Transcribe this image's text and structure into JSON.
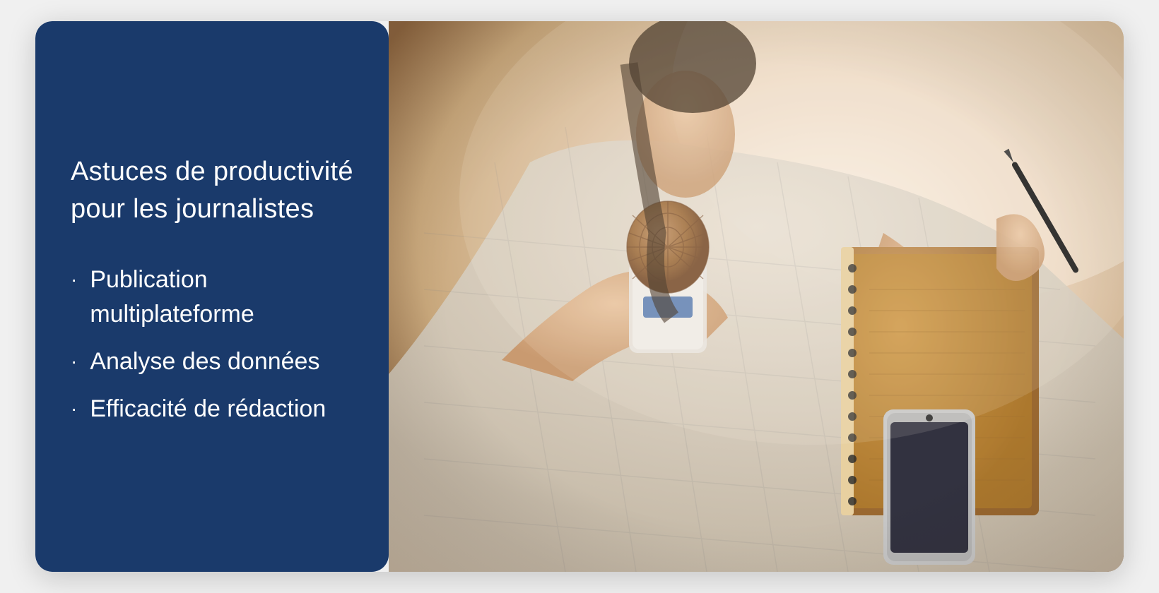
{
  "left_panel": {
    "background_color": "#1a3a6b",
    "title_line1": "Astuces de productivité",
    "title_line2": "pour les journalistes",
    "bullets": [
      {
        "id": "bullet-1",
        "label": "Publication multiplateforme"
      },
      {
        "id": "bullet-2",
        "label": "Analyse des données"
      },
      {
        "id": "bullet-3",
        "label": "Efficacité de rédaction"
      }
    ]
  },
  "right_panel": {
    "image_description": "Journalist holding microphone, notebook and phone"
  }
}
